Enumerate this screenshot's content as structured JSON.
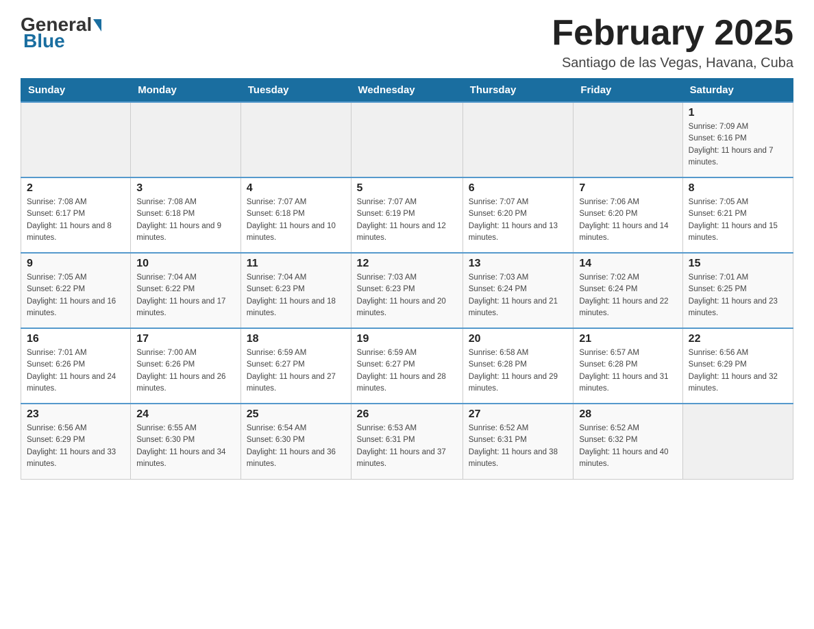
{
  "header": {
    "logo_general": "General",
    "logo_blue": "Blue",
    "month_title": "February 2025",
    "subtitle": "Santiago de las Vegas, Havana, Cuba"
  },
  "days_of_week": [
    "Sunday",
    "Monday",
    "Tuesday",
    "Wednesday",
    "Thursday",
    "Friday",
    "Saturday"
  ],
  "weeks": [
    [
      {
        "day": "",
        "info": ""
      },
      {
        "day": "",
        "info": ""
      },
      {
        "day": "",
        "info": ""
      },
      {
        "day": "",
        "info": ""
      },
      {
        "day": "",
        "info": ""
      },
      {
        "day": "",
        "info": ""
      },
      {
        "day": "1",
        "info": "Sunrise: 7:09 AM\nSunset: 6:16 PM\nDaylight: 11 hours and 7 minutes."
      }
    ],
    [
      {
        "day": "2",
        "info": "Sunrise: 7:08 AM\nSunset: 6:17 PM\nDaylight: 11 hours and 8 minutes."
      },
      {
        "day": "3",
        "info": "Sunrise: 7:08 AM\nSunset: 6:18 PM\nDaylight: 11 hours and 9 minutes."
      },
      {
        "day": "4",
        "info": "Sunrise: 7:07 AM\nSunset: 6:18 PM\nDaylight: 11 hours and 10 minutes."
      },
      {
        "day": "5",
        "info": "Sunrise: 7:07 AM\nSunset: 6:19 PM\nDaylight: 11 hours and 12 minutes."
      },
      {
        "day": "6",
        "info": "Sunrise: 7:07 AM\nSunset: 6:20 PM\nDaylight: 11 hours and 13 minutes."
      },
      {
        "day": "7",
        "info": "Sunrise: 7:06 AM\nSunset: 6:20 PM\nDaylight: 11 hours and 14 minutes."
      },
      {
        "day": "8",
        "info": "Sunrise: 7:05 AM\nSunset: 6:21 PM\nDaylight: 11 hours and 15 minutes."
      }
    ],
    [
      {
        "day": "9",
        "info": "Sunrise: 7:05 AM\nSunset: 6:22 PM\nDaylight: 11 hours and 16 minutes."
      },
      {
        "day": "10",
        "info": "Sunrise: 7:04 AM\nSunset: 6:22 PM\nDaylight: 11 hours and 17 minutes."
      },
      {
        "day": "11",
        "info": "Sunrise: 7:04 AM\nSunset: 6:23 PM\nDaylight: 11 hours and 18 minutes."
      },
      {
        "day": "12",
        "info": "Sunrise: 7:03 AM\nSunset: 6:23 PM\nDaylight: 11 hours and 20 minutes."
      },
      {
        "day": "13",
        "info": "Sunrise: 7:03 AM\nSunset: 6:24 PM\nDaylight: 11 hours and 21 minutes."
      },
      {
        "day": "14",
        "info": "Sunrise: 7:02 AM\nSunset: 6:24 PM\nDaylight: 11 hours and 22 minutes."
      },
      {
        "day": "15",
        "info": "Sunrise: 7:01 AM\nSunset: 6:25 PM\nDaylight: 11 hours and 23 minutes."
      }
    ],
    [
      {
        "day": "16",
        "info": "Sunrise: 7:01 AM\nSunset: 6:26 PM\nDaylight: 11 hours and 24 minutes."
      },
      {
        "day": "17",
        "info": "Sunrise: 7:00 AM\nSunset: 6:26 PM\nDaylight: 11 hours and 26 minutes."
      },
      {
        "day": "18",
        "info": "Sunrise: 6:59 AM\nSunset: 6:27 PM\nDaylight: 11 hours and 27 minutes."
      },
      {
        "day": "19",
        "info": "Sunrise: 6:59 AM\nSunset: 6:27 PM\nDaylight: 11 hours and 28 minutes."
      },
      {
        "day": "20",
        "info": "Sunrise: 6:58 AM\nSunset: 6:28 PM\nDaylight: 11 hours and 29 minutes."
      },
      {
        "day": "21",
        "info": "Sunrise: 6:57 AM\nSunset: 6:28 PM\nDaylight: 11 hours and 31 minutes."
      },
      {
        "day": "22",
        "info": "Sunrise: 6:56 AM\nSunset: 6:29 PM\nDaylight: 11 hours and 32 minutes."
      }
    ],
    [
      {
        "day": "23",
        "info": "Sunrise: 6:56 AM\nSunset: 6:29 PM\nDaylight: 11 hours and 33 minutes."
      },
      {
        "day": "24",
        "info": "Sunrise: 6:55 AM\nSunset: 6:30 PM\nDaylight: 11 hours and 34 minutes."
      },
      {
        "day": "25",
        "info": "Sunrise: 6:54 AM\nSunset: 6:30 PM\nDaylight: 11 hours and 36 minutes."
      },
      {
        "day": "26",
        "info": "Sunrise: 6:53 AM\nSunset: 6:31 PM\nDaylight: 11 hours and 37 minutes."
      },
      {
        "day": "27",
        "info": "Sunrise: 6:52 AM\nSunset: 6:31 PM\nDaylight: 11 hours and 38 minutes."
      },
      {
        "day": "28",
        "info": "Sunrise: 6:52 AM\nSunset: 6:32 PM\nDaylight: 11 hours and 40 minutes."
      },
      {
        "day": "",
        "info": ""
      }
    ]
  ]
}
